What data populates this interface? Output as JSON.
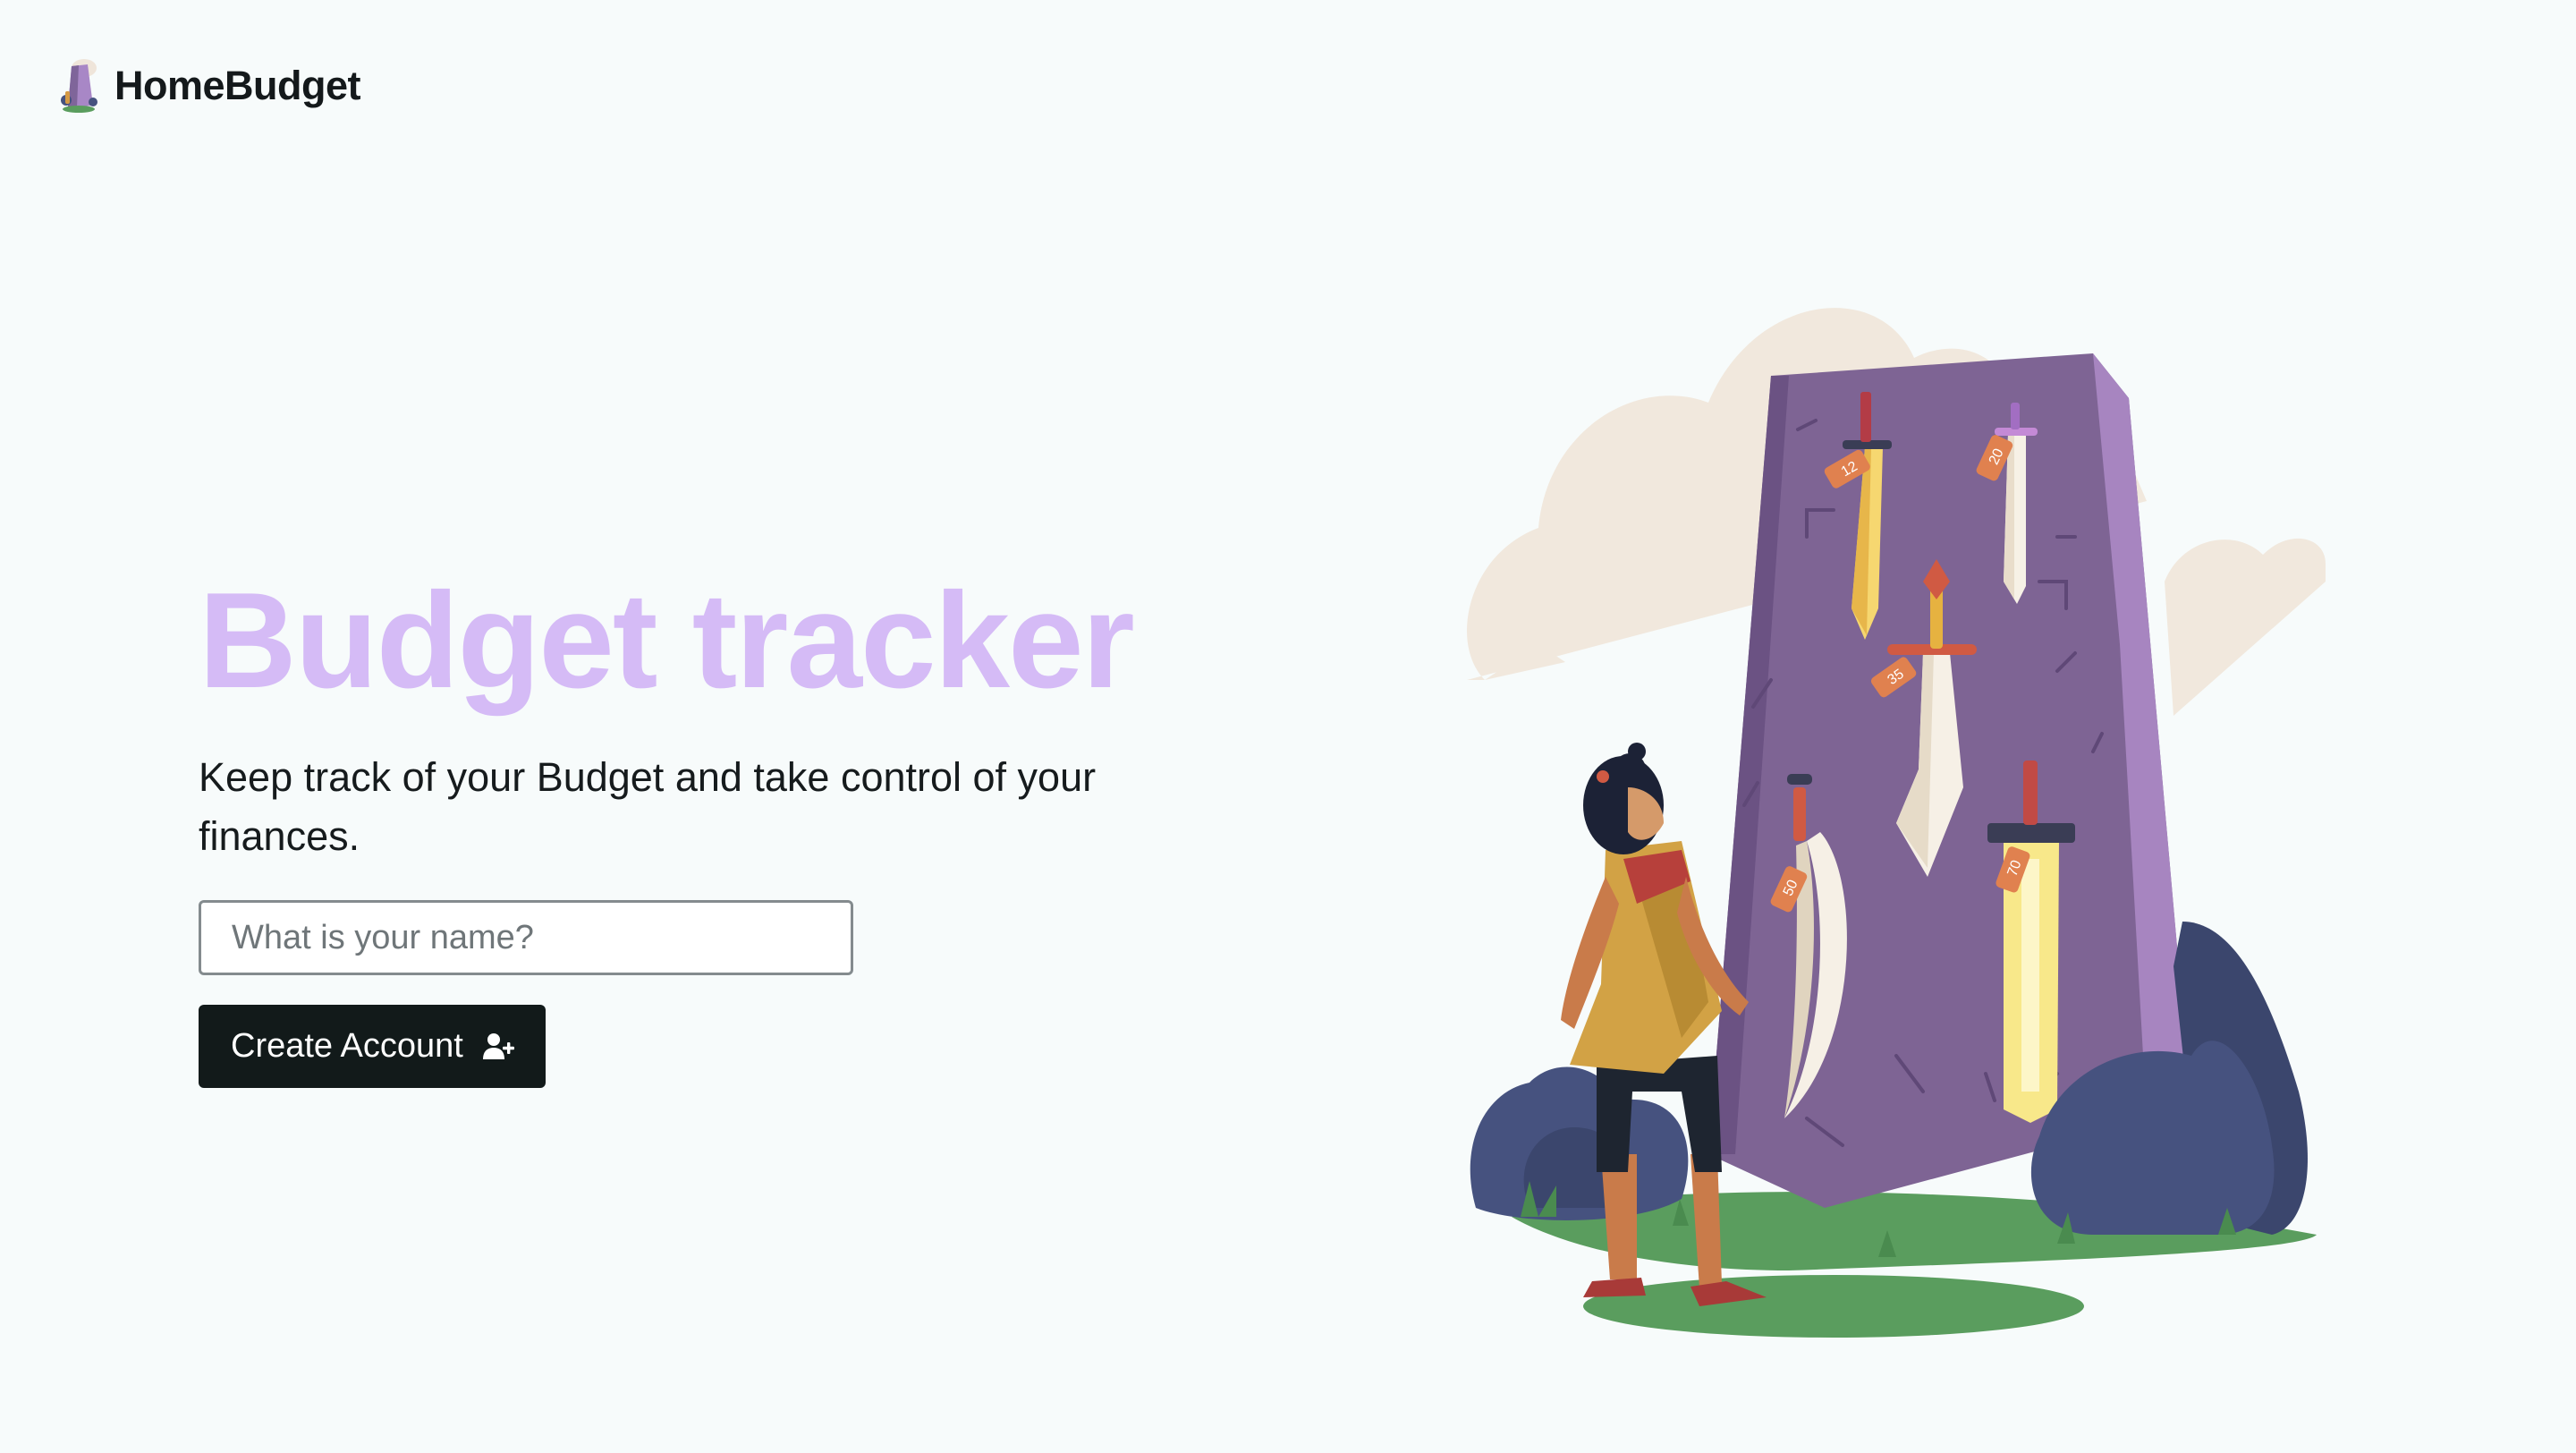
{
  "header": {
    "brand_name": "HomeBudget",
    "logo_icon": "obelisk-logo-icon"
  },
  "hero": {
    "title": "Budget tracker",
    "subtitle": "Keep track of your Budget and take control of your finances.",
    "name_input": {
      "placeholder": "What is your name?",
      "value": ""
    },
    "create_button": {
      "label": "Create Account",
      "icon": "add-user-icon"
    }
  },
  "illustration": {
    "price_tags": [
      "12",
      "20",
      "35",
      "50",
      "70"
    ]
  },
  "colors": {
    "background": "#f7fbfb",
    "title_accent": "#d5bbf6",
    "button_bg": "#121a1a",
    "stone_purple": "#7e6494",
    "stone_edge": "#a785c0",
    "grass_green": "#5a9d5e",
    "rock_blue": "#46527f",
    "cloud_beige": "#f1e8dd"
  }
}
